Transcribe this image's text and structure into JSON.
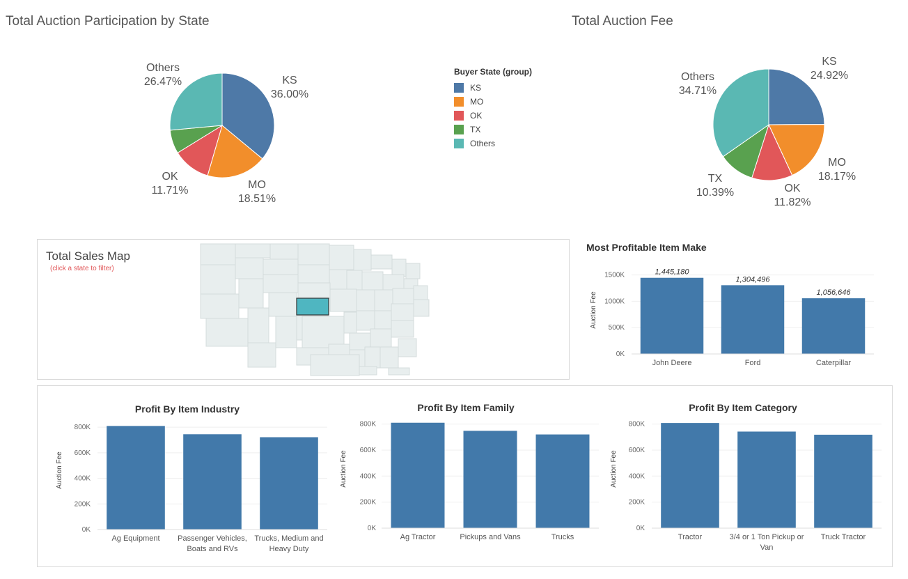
{
  "colors": {
    "KS": "#4e79a7",
    "MO": "#f28e2b",
    "OK": "#e15759",
    "TX": "#59a14f",
    "Others": "#5ab8b3",
    "bar": "#4279aa",
    "map_fill": "#e8eeee",
    "map_highlight": "#4fb6c1"
  },
  "participation": {
    "title": "Total Auction Participation by State"
  },
  "fee": {
    "title": "Total Auction Fee"
  },
  "legend": {
    "title": "Buyer State (group)",
    "items": [
      "KS",
      "MO",
      "OK",
      "TX",
      "Others"
    ]
  },
  "map": {
    "title": "Total Sales Map",
    "hint": "(click a state to filter)",
    "highlighted_state": "KS"
  },
  "chart_data": [
    {
      "id": "participation",
      "type": "pie",
      "title": "Total Auction Participation by State",
      "categories": [
        "KS",
        "MO",
        "OK",
        "TX",
        "Others"
      ],
      "values": [
        36.0,
        18.51,
        11.71,
        7.31,
        26.47
      ],
      "labels": [
        "36.00%",
        "18.51%",
        "11.71%",
        "",
        "26.47%"
      ]
    },
    {
      "id": "fee",
      "type": "pie",
      "title": "Total Auction Fee",
      "categories": [
        "KS",
        "MO",
        "OK",
        "TX",
        "Others"
      ],
      "values": [
        24.92,
        18.17,
        11.82,
        10.39,
        34.71
      ],
      "labels": [
        "24.92%",
        "18.17%",
        "11.82%",
        "10.39%",
        "34.71%"
      ]
    },
    {
      "id": "make",
      "type": "bar",
      "title": "Most Profitable Item Make",
      "ylabel": "Auction Fee",
      "categories": [
        "John Deere",
        "Ford",
        "Caterpillar"
      ],
      "values": [
        1445180,
        1304496,
        1056646
      ],
      "data_labels": [
        "1,445,180",
        "1,304,496",
        "1,056,646"
      ],
      "yticks": [
        0,
        500000,
        1000000,
        1500000
      ],
      "ytick_labels": [
        "0K",
        "500K",
        "1000K",
        "1500K"
      ],
      "ylim": [
        0,
        1600000
      ]
    },
    {
      "id": "industry",
      "type": "bar",
      "title": "Profit By Item Industry",
      "ylabel": "Auction Fee",
      "categories": [
        [
          "Ag Equipment"
        ],
        [
          "Passenger Vehicles,",
          "Boats and RVs"
        ],
        [
          "Trucks, Medium and",
          "Heavy Duty"
        ]
      ],
      "values": [
        810000,
        745000,
        722000
      ],
      "yticks": [
        0,
        200000,
        400000,
        600000,
        800000
      ],
      "ytick_labels": [
        "0K",
        "200K",
        "400K",
        "600K",
        "800K"
      ],
      "ylim": [
        0,
        850000
      ]
    },
    {
      "id": "family",
      "type": "bar",
      "title": "Profit By Item Family",
      "ylabel": "Auction Fee",
      "categories": [
        [
          "Ag Tractor"
        ],
        [
          "Pickups and Vans"
        ],
        [
          "Trucks"
        ]
      ],
      "values": [
        810000,
        748000,
        720000
      ],
      "yticks": [
        0,
        200000,
        400000,
        600000,
        800000
      ],
      "ytick_labels": [
        "0K",
        "200K",
        "400K",
        "600K",
        "800K"
      ],
      "ylim": [
        0,
        830000
      ]
    },
    {
      "id": "category",
      "type": "bar",
      "title": "Profit By Item Category",
      "ylabel": "Auction Fee",
      "categories": [
        [
          "Tractor"
        ],
        [
          "3/4 or 1 Ton Pickup or",
          "Van"
        ],
        [
          "Truck Tractor"
        ]
      ],
      "values": [
        808000,
        742000,
        718000
      ],
      "yticks": [
        0,
        200000,
        400000,
        600000,
        800000
      ],
      "ytick_labels": [
        "0K",
        "200K",
        "400K",
        "600K",
        "800K"
      ],
      "ylim": [
        0,
        830000
      ]
    }
  ]
}
